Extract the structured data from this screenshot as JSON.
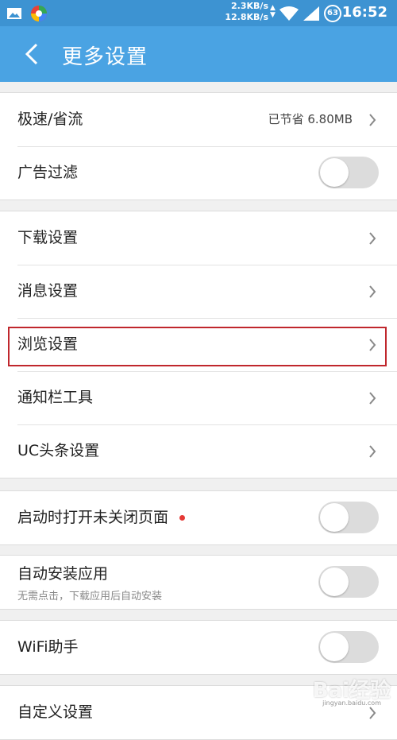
{
  "status_bar": {
    "download_speed": "2.3KB/s",
    "upload_speed": "12.8KB/s",
    "battery": "63",
    "time": "16:52"
  },
  "header": {
    "title": "更多设置",
    "accent_color": "#4aa3e3"
  },
  "groups": [
    {
      "items": [
        {
          "label": "极速/省流",
          "value": "已节省 6.80MB",
          "control": "chevron"
        },
        {
          "label": "广告过滤",
          "control": "toggle",
          "on": false
        }
      ]
    },
    {
      "items": [
        {
          "label": "下载设置",
          "control": "chevron"
        },
        {
          "label": "消息设置",
          "control": "chevron"
        },
        {
          "label": "浏览设置",
          "control": "chevron",
          "highlighted": true
        },
        {
          "label": "通知栏工具",
          "control": "chevron"
        },
        {
          "label": "UC头条设置",
          "control": "chevron"
        }
      ]
    },
    {
      "items": [
        {
          "label": "启动时打开未关闭页面",
          "control": "toggle",
          "on": false,
          "red_dot": true
        }
      ]
    },
    {
      "items": [
        {
          "label": "自动安装应用",
          "sublabel": "无需点击，下载应用后自动安装",
          "control": "toggle",
          "on": false
        }
      ]
    },
    {
      "items": [
        {
          "label": "WiFi助手",
          "control": "toggle",
          "on": false
        }
      ]
    },
    {
      "items": [
        {
          "label": "自定义设置",
          "control": "chevron"
        }
      ]
    }
  ],
  "watermark": {
    "text": "Bai经验",
    "sub": "jingyan.baidu.com"
  }
}
